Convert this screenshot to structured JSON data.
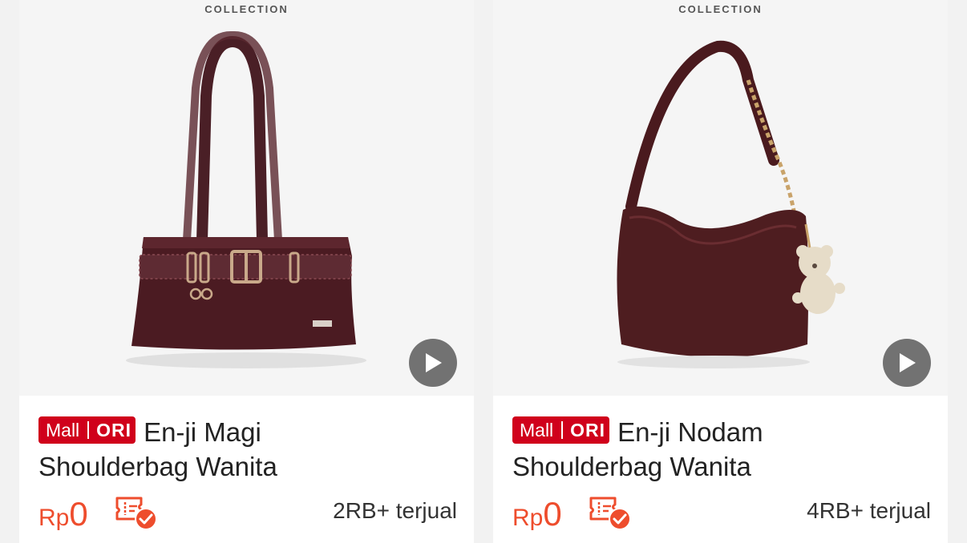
{
  "colors": {
    "accent": "#ee4d2d",
    "mall_badge": "#d0011b",
    "page_background": "#f2f2f2"
  },
  "products": [
    {
      "brand": "COLLECTION",
      "badge_mall": "Mall",
      "badge_ori": "ORI",
      "name_line1": "En-ji Magi",
      "name_line2": "Shoulderbag Wanita",
      "price_currency": "Rp",
      "price_value": "0",
      "sold": "2RB+ terjual",
      "icons": [
        "play-icon",
        "voucher-check-icon"
      ]
    },
    {
      "brand": "COLLECTION",
      "badge_mall": "Mall",
      "badge_ori": "ORI",
      "name_line1": "En-ji Nodam",
      "name_line2": "Shoulderbag Wanita",
      "price_currency": "Rp",
      "price_value": "0",
      "sold": "4RB+ terjual",
      "icons": [
        "play-icon",
        "voucher-check-icon"
      ]
    }
  ]
}
